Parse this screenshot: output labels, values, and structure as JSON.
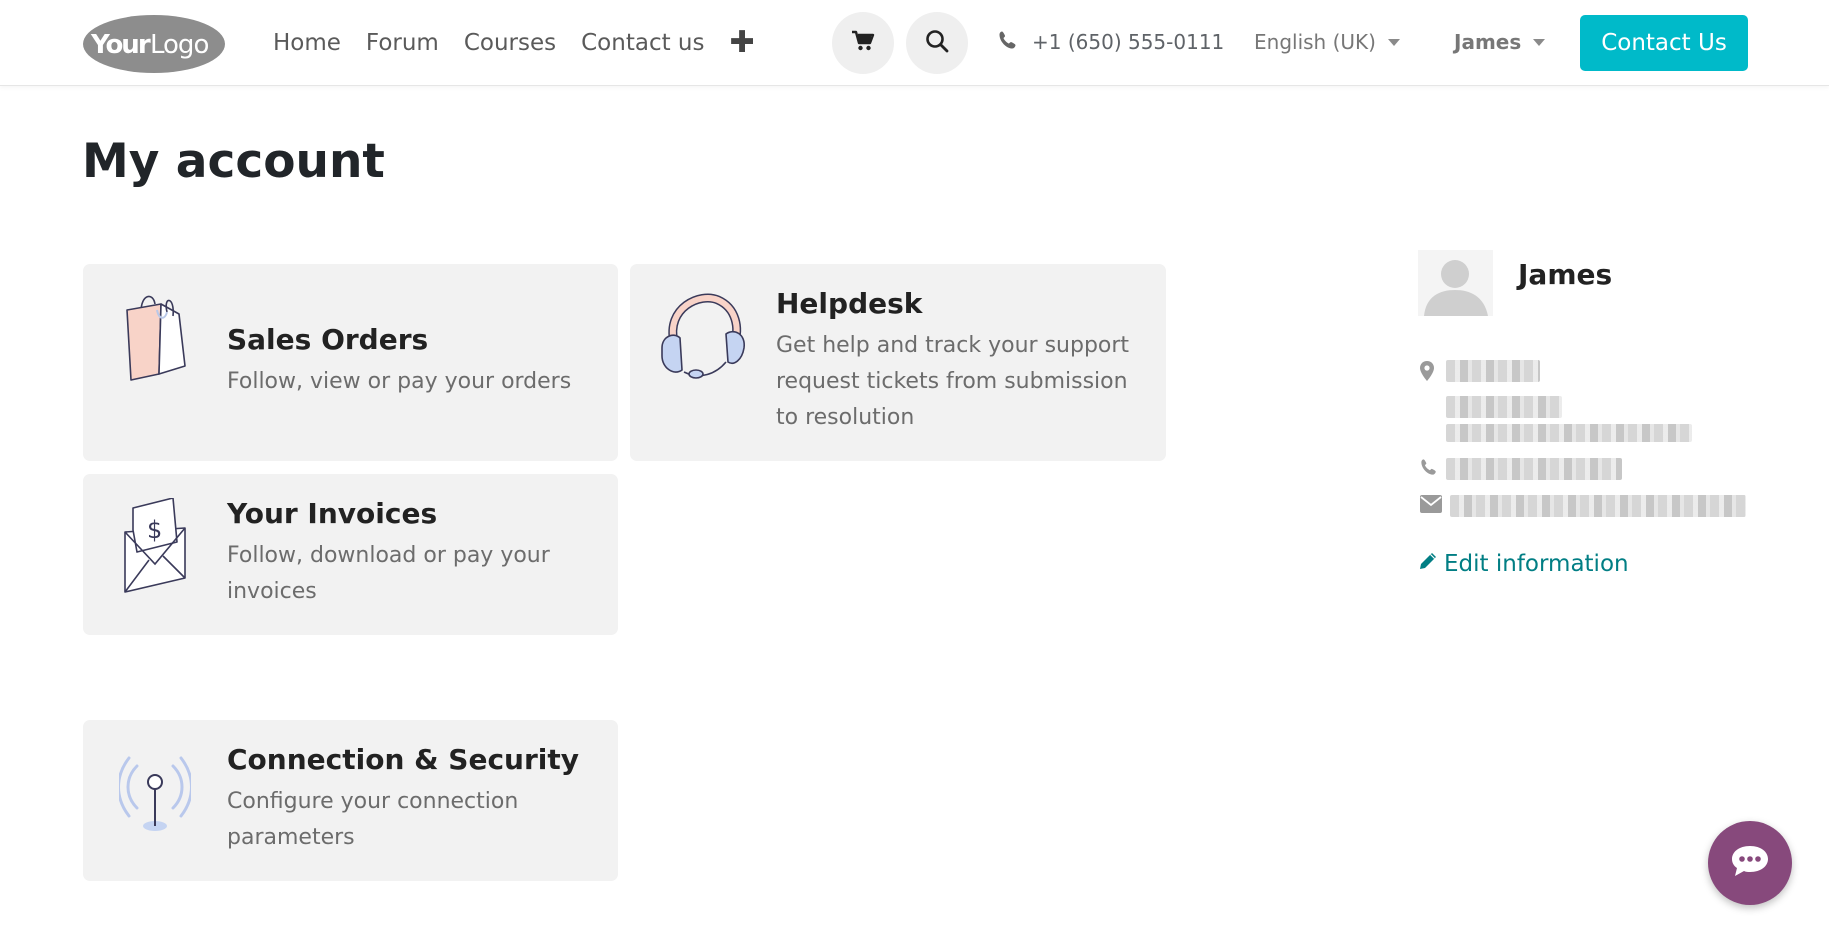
{
  "header": {
    "logo_text": "YourLogo",
    "nav": [
      "Home",
      "Forum",
      "Courses",
      "Contact us"
    ],
    "plus_icon": "plus-icon",
    "cart_icon": "cart-icon",
    "search_icon": "search-icon",
    "phone": "+1 (650) 555-0111",
    "language": "English (UK)",
    "user": "James",
    "contact_button": "Contact Us",
    "accent_color": "#00bac9"
  },
  "main": {
    "title": "My account",
    "cards": [
      {
        "title": "Sales Orders",
        "desc": "Follow, view or pay your orders",
        "icon": "shopping-bag-icon"
      },
      {
        "title": "Helpdesk",
        "desc": "Get help and track your support request tickets from submission to resolution",
        "icon": "headset-icon"
      },
      {
        "title": "Your Invoices",
        "desc": "Follow, download or pay your invoices",
        "icon": "invoice-envelope-icon"
      },
      {
        "title": "Connection & Security",
        "desc": "Configure your connection parameters",
        "icon": "antenna-icon"
      }
    ]
  },
  "sidebar": {
    "name": "James",
    "edit_label": "Edit information",
    "link_color": "#017e84"
  },
  "chat": {
    "icon": "chat-bubble-icon",
    "color": "#87497c"
  }
}
